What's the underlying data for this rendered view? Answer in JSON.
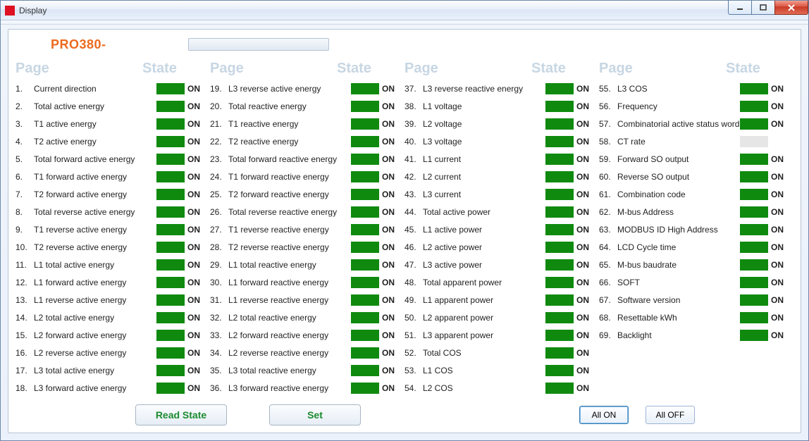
{
  "window": {
    "title": "Display"
  },
  "product": {
    "prefix": "PRO380-",
    "suffix": ""
  },
  "headers": {
    "page": "Page",
    "state": "State"
  },
  "buttons": {
    "read_state": "Read State",
    "set": "Set",
    "all_on": "All ON",
    "all_off": "All OFF"
  },
  "state_on_label": "ON",
  "items": [
    {
      "n": "1.",
      "label": "Current direction",
      "state": "ON"
    },
    {
      "n": "2.",
      "label": "Total active energy",
      "state": "ON"
    },
    {
      "n": "3.",
      "label": "T1 active energy",
      "state": "ON"
    },
    {
      "n": "4.",
      "label": "T2 active energy",
      "state": "ON"
    },
    {
      "n": "5.",
      "label": "Total forward active energy",
      "state": "ON"
    },
    {
      "n": "6.",
      "label": "T1 forward active energy",
      "state": "ON"
    },
    {
      "n": "7.",
      "label": "T2 forward active energy",
      "state": "ON"
    },
    {
      "n": "8.",
      "label": "Total reverse active energy",
      "state": "ON"
    },
    {
      "n": "9.",
      "label": "T1 reverse active energy",
      "state": "ON"
    },
    {
      "n": "10.",
      "label": "T2 reverse active energy",
      "state": "ON"
    },
    {
      "n": "11.",
      "label": "L1 total active energy",
      "state": "ON"
    },
    {
      "n": "12.",
      "label": "L1 forward active energy",
      "state": "ON"
    },
    {
      "n": "13.",
      "label": "L1 reverse active energy",
      "state": "ON"
    },
    {
      "n": "14.",
      "label": "L2 total active energy",
      "state": "ON"
    },
    {
      "n": "15.",
      "label": "L2 forward active energy",
      "state": "ON"
    },
    {
      "n": "16.",
      "label": "L2 reverse active energy",
      "state": "ON"
    },
    {
      "n": "17.",
      "label": "L3 total active energy",
      "state": "ON"
    },
    {
      "n": "18.",
      "label": "L3 forward active energy",
      "state": "ON"
    },
    {
      "n": "19.",
      "label": "L3 reverse active energy",
      "state": "ON"
    },
    {
      "n": "20.",
      "label": "Total reactive energy",
      "state": "ON"
    },
    {
      "n": "21.",
      "label": "T1 reactive energy",
      "state": "ON"
    },
    {
      "n": "22.",
      "label": "T2 reactive energy",
      "state": "ON"
    },
    {
      "n": "23.",
      "label": "Total forward reactive energy",
      "state": "ON"
    },
    {
      "n": "24.",
      "label": "T1 forward reactive energy",
      "state": "ON"
    },
    {
      "n": "25.",
      "label": "T2 forward reactive energy",
      "state": "ON"
    },
    {
      "n": "26.",
      "label": "Total reverse reactive energy",
      "state": "ON"
    },
    {
      "n": "27.",
      "label": "T1 reverse reactive energy",
      "state": "ON"
    },
    {
      "n": "28.",
      "label": "T2 reverse reactive energy",
      "state": "ON"
    },
    {
      "n": "29.",
      "label": "L1 total reactive energy",
      "state": "ON"
    },
    {
      "n": "30.",
      "label": "L1 forward reactive energy",
      "state": "ON"
    },
    {
      "n": "31.",
      "label": "L1 reverse reactive energy",
      "state": "ON"
    },
    {
      "n": "32.",
      "label": "L2 total reactive energy",
      "state": "ON"
    },
    {
      "n": "33.",
      "label": "L2 forward reactive energy",
      "state": "ON"
    },
    {
      "n": "34.",
      "label": "L2 reverse reactive energy",
      "state": "ON"
    },
    {
      "n": "35.",
      "label": "L3 total reactive energy",
      "state": "ON"
    },
    {
      "n": "36.",
      "label": "L3 forward reactive energy",
      "state": "ON"
    },
    {
      "n": "37.",
      "label": "L3 reverse reactive energy",
      "state": "ON"
    },
    {
      "n": "38.",
      "label": "L1 voltage",
      "state": "ON"
    },
    {
      "n": "39.",
      "label": "L2 voltage",
      "state": "ON"
    },
    {
      "n": "40.",
      "label": "L3 voltage",
      "state": "ON"
    },
    {
      "n": "41.",
      "label": "L1 current",
      "state": "ON"
    },
    {
      "n": "42.",
      "label": "L2 current",
      "state": "ON"
    },
    {
      "n": "43.",
      "label": "L3 current",
      "state": "ON"
    },
    {
      "n": "44.",
      "label": "Total active power",
      "state": "ON"
    },
    {
      "n": "45.",
      "label": "L1 active power",
      "state": "ON"
    },
    {
      "n": "46.",
      "label": "L2 active power",
      "state": "ON"
    },
    {
      "n": "47.",
      "label": "L3 active power",
      "state": "ON"
    },
    {
      "n": "48.",
      "label": "Total apparent power",
      "state": "ON"
    },
    {
      "n": "49.",
      "label": "L1 apparent power",
      "state": "ON"
    },
    {
      "n": "50.",
      "label": "L2 apparent power",
      "state": "ON"
    },
    {
      "n": "51.",
      "label": "L3 apparent power",
      "state": "ON"
    },
    {
      "n": "52.",
      "label": "Total COS",
      "state": "ON"
    },
    {
      "n": "53.",
      "label": "L1 COS",
      "state": "ON"
    },
    {
      "n": "54.",
      "label": "L2 COS",
      "state": "ON"
    },
    {
      "n": "55.",
      "label": "L3 COS",
      "state": "ON"
    },
    {
      "n": "56.",
      "label": "Frequency",
      "state": "ON"
    },
    {
      "n": "57.",
      "label": "Combinatorial active status word",
      "state": "ON"
    },
    {
      "n": "58.",
      "label": "CT rate",
      "state": ""
    },
    {
      "n": "59.",
      "label": "Forward SO output",
      "state": "ON"
    },
    {
      "n": "60.",
      "label": "Reverse SO output",
      "state": "ON"
    },
    {
      "n": "61.",
      "label": "Combination code",
      "state": "ON"
    },
    {
      "n": "62.",
      "label": "M-bus Address",
      "state": "ON"
    },
    {
      "n": "63.",
      "label": "MODBUS ID    High Address",
      "state": "ON"
    },
    {
      "n": "64.",
      "label": "LCD Cycle time",
      "state": "ON"
    },
    {
      "n": "65.",
      "label": "M-bus baudrate",
      "state": "ON"
    },
    {
      "n": "66.",
      "label": "SOFT",
      "state": "ON"
    },
    {
      "n": "67.",
      "label": "Software version",
      "state": "ON"
    },
    {
      "n": "68.",
      "label": "Resettable kWh",
      "state": "ON"
    },
    {
      "n": "69.",
      "label": "Backlight",
      "state": "ON"
    }
  ]
}
